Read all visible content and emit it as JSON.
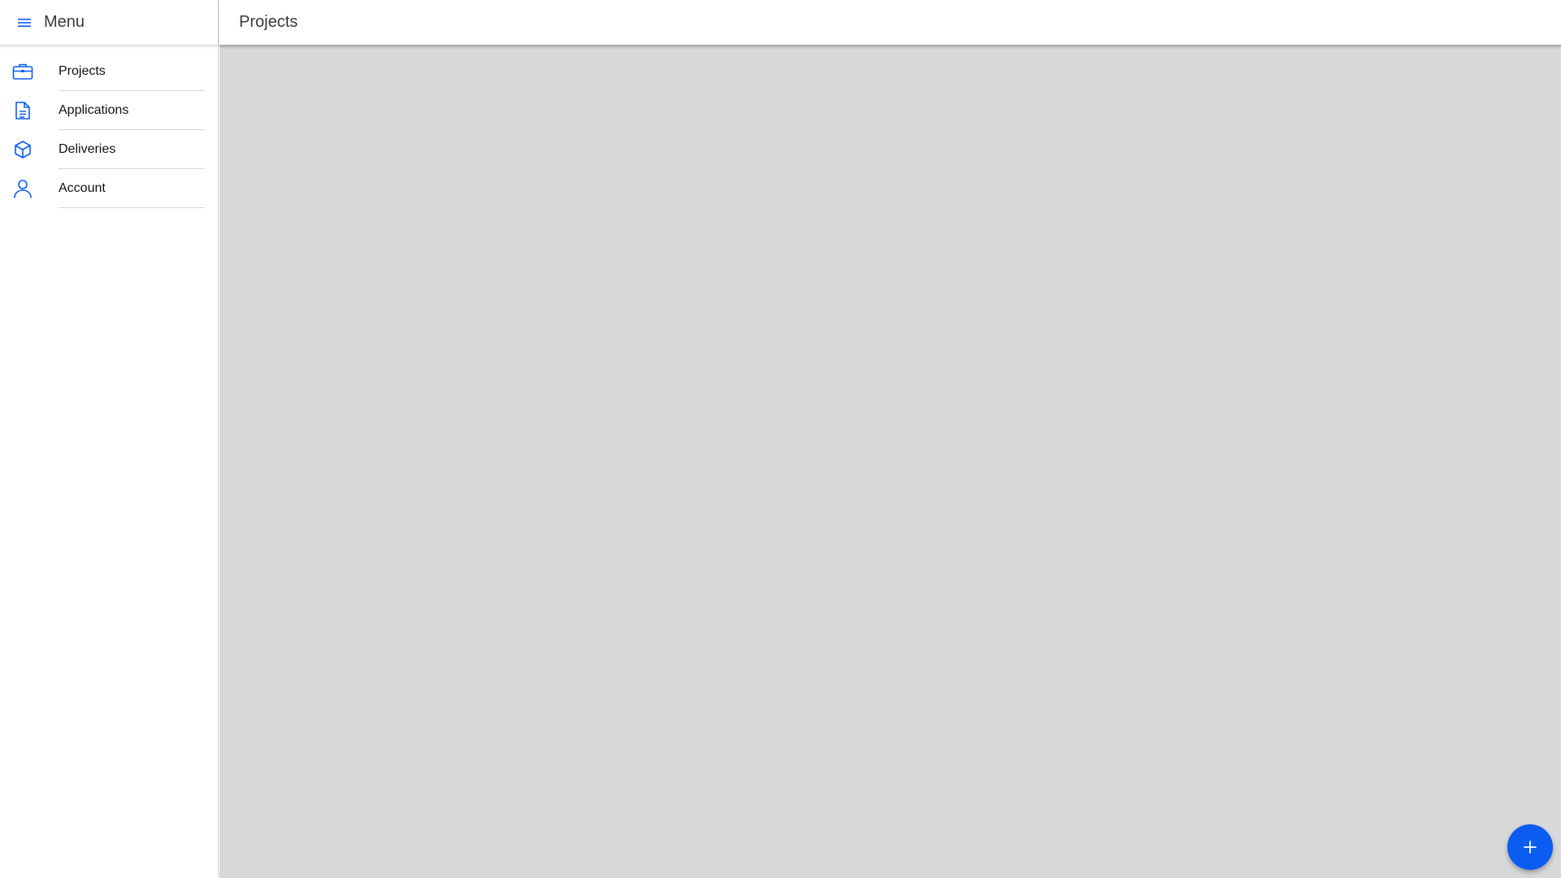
{
  "sidebar": {
    "title": "Menu",
    "items": [
      {
        "label": "Projects",
        "icon": "briefcase-icon"
      },
      {
        "label": "Applications",
        "icon": "document-icon"
      },
      {
        "label": "Deliveries",
        "icon": "box-icon"
      },
      {
        "label": "Account",
        "icon": "user-icon"
      }
    ]
  },
  "header": {
    "title": "Projects"
  },
  "fab": {
    "icon": "plus-icon"
  },
  "colors": {
    "accent": "#0b5cf0",
    "content_bg": "#d7d8da"
  }
}
